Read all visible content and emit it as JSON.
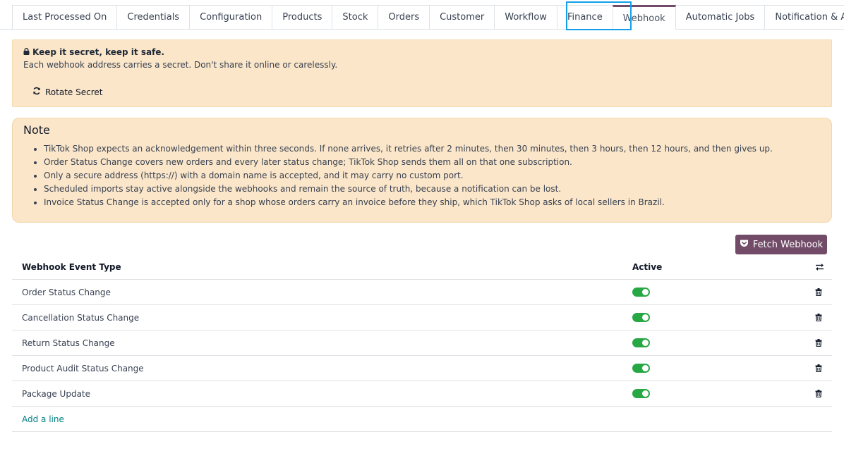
{
  "tabs": [
    {
      "label": "Last Processed On"
    },
    {
      "label": "Credentials"
    },
    {
      "label": "Configuration"
    },
    {
      "label": "Products"
    },
    {
      "label": "Stock"
    },
    {
      "label": "Orders"
    },
    {
      "label": "Customer"
    },
    {
      "label": "Workflow"
    },
    {
      "label": "Finance"
    },
    {
      "label": "Webhook",
      "active": true
    },
    {
      "label": "Automatic Jobs"
    },
    {
      "label": "Notification & Alerts"
    }
  ],
  "secret_alert": {
    "title": "Keep it secret, keep it safe.",
    "text": "Each webhook address carries a secret. Don't share it online or carelessly.",
    "rotate_label": "Rotate Secret"
  },
  "note": {
    "title": "Note",
    "items": [
      "TikTok Shop expects an acknowledgement within three seconds. If none arrives, it retries after 2 minutes, then 30 minutes, then 3 hours, then 12 hours, and then gives up.",
      "Order Status Change covers new orders and every later status change; TikTok Shop sends them all on that one subscription.",
      "Only a secure address (https://) with a domain name is accepted, and it may carry no custom port.",
      "Scheduled imports stay active alongside the webhooks and remain the source of truth, because a notification can be lost.",
      "Invoice Status Change is accepted only for a shop whose orders carry an invoice before they ship, which TikTok Shop asks of local sellers in Brazil."
    ]
  },
  "fetch_button": {
    "label": "Fetch Webhook"
  },
  "table": {
    "headers": {
      "event_type": "Webhook Event Type",
      "active": "Active"
    },
    "rows": [
      {
        "event_type": "Order Status Change",
        "active": true
      },
      {
        "event_type": "Cancellation Status Change",
        "active": true
      },
      {
        "event_type": "Return Status Change",
        "active": true
      },
      {
        "event_type": "Product Audit Status Change",
        "active": true
      },
      {
        "event_type": "Package Update",
        "active": true
      }
    ],
    "add_line_label": "Add a line"
  },
  "colors": {
    "primary": "#714b67",
    "alert_bg": "#fbe6c9",
    "toggle_on": "#28a745",
    "link": "#017e84",
    "focus_ring": "#12a0ea"
  },
  "icons": {
    "lock": "lock-icon",
    "rotate": "refresh-icon",
    "fetch": "pocket-icon",
    "column_settings": "sliders-icon",
    "delete": "trash-icon"
  }
}
